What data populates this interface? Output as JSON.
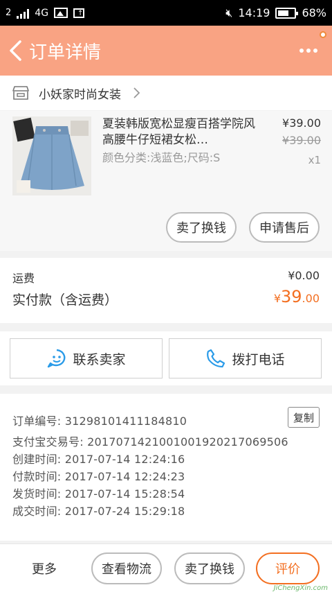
{
  "status_bar": {
    "sim": "2",
    "network": "4G",
    "time": "14:19",
    "battery": "68%",
    "battery_level": 0.68
  },
  "header": {
    "title": "订单详情"
  },
  "shop": {
    "name": "小妖家时尚女装"
  },
  "product": {
    "title": "夏装韩版宽松显瘦百搭学院风高腰牛仔短裙女松…",
    "sku": "颜色分类:浅蓝色;尺码:S",
    "price": "¥39.00",
    "original_price": "¥39.00",
    "quantity": "x1",
    "sell_button": "卖了换钱",
    "after_sale_button": "申请售后"
  },
  "fees": {
    "shipping_label": "运费",
    "shipping_value": "¥0.00",
    "paid_label": "实付款（含运费）",
    "paid_currency": "¥",
    "paid_integer": "39",
    "paid_decimal": ".00"
  },
  "contact": {
    "seller_button": "联系卖家",
    "phone_button": "拨打电话"
  },
  "order_info": {
    "order_no_label": "订单编号:",
    "order_no": "31298101411184810",
    "copy_button": "复制",
    "alipay_label": "支付宝交易号:",
    "alipay_no": "2017071421001001920217069506",
    "created_label": "创建时间:",
    "created": "2017-07-14 12:24:16",
    "paid_label": "付款时间:",
    "paid": "2017-07-14 12:24:23",
    "shipped_label": "发货时间:",
    "shipped": "2017-07-14 15:28:54",
    "completed_label": "成交时间:",
    "completed": "2017-07-24 15:29:18"
  },
  "bottom_bar": {
    "more": "更多",
    "logistics_button": "查看物流",
    "sell_button": "卖了换钱",
    "review_button": "评价"
  },
  "watermark": {
    "text": "JiChengXin.com"
  },
  "colors": {
    "header_bg": "#f9a383",
    "accent": "#f36f21",
    "contact_icon": "#2a9be8"
  }
}
